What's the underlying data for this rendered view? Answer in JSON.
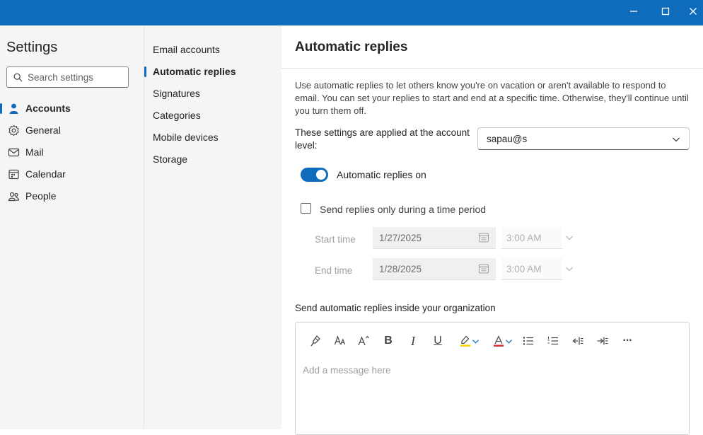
{
  "colors": {
    "accent": "#0f6cbd",
    "panel_bg": "#f5f5f5",
    "titlebar": "#0f6cbd"
  },
  "window_controls": {
    "minimize_icon": "minimize-icon",
    "maximize_icon": "maximize-icon",
    "close_icon": "close-icon"
  },
  "sidebar": {
    "title": "Settings",
    "search_placeholder": "Search settings",
    "items": [
      {
        "label": "Accounts",
        "icon": "person-icon",
        "active": true
      },
      {
        "label": "General",
        "icon": "gear-icon",
        "active": false
      },
      {
        "label": "Mail",
        "icon": "mail-icon",
        "active": false
      },
      {
        "label": "Calendar",
        "icon": "calendar-icon",
        "active": false
      },
      {
        "label": "People",
        "icon": "people-icon",
        "active": false
      }
    ]
  },
  "subnav": {
    "items": [
      {
        "label": "Email accounts",
        "active": false
      },
      {
        "label": "Automatic replies",
        "active": true
      },
      {
        "label": "Signatures",
        "active": false
      },
      {
        "label": "Categories",
        "active": false
      },
      {
        "label": "Mobile devices",
        "active": false
      },
      {
        "label": "Storage",
        "active": false
      }
    ]
  },
  "main": {
    "title": "Automatic replies",
    "description": "Use automatic replies to let others know you're on vacation or aren't available to respond to email. You can set your replies to start and end at a specific time. Otherwise, they'll continue until you turn them off.",
    "account_label": "These settings are applied at the account level:",
    "account_value": "sapau@s",
    "toggle_label": "Automatic replies on",
    "toggle_on": true,
    "time_period_label": "Send replies only during a time period",
    "time_period_checked": false,
    "start_time_label": "Start time",
    "start_date": "1/27/2025",
    "start_time": "3:00 AM",
    "end_time_label": "End time",
    "end_date": "1/28/2025",
    "end_time": "3:00 AM",
    "inside_org_label": "Send automatic replies inside your organization",
    "message_placeholder": "Add a message here",
    "toolbar": {
      "bold": "B",
      "italic": "I",
      "underline": "U",
      "more": "···",
      "icons": [
        "format-painter-icon",
        "font-size-icon",
        "grow-font-icon",
        "bold-icon",
        "italic-icon",
        "underline-icon",
        "highlight-icon",
        "font-color-icon",
        "bullets-icon",
        "numbering-icon",
        "decrease-indent-icon",
        "increase-indent-icon",
        "more-options-icon"
      ]
    }
  }
}
